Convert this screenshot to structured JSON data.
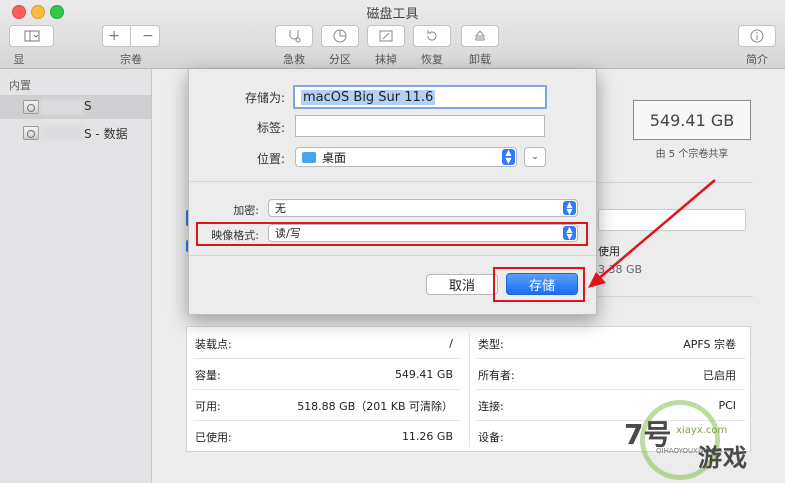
{
  "window": {
    "title": "磁盘工具"
  },
  "toolbar": {
    "display_label": "显示",
    "volume_label": "宗卷",
    "add_symbol": "+",
    "remove_symbol": "−",
    "firstaid_label": "急救",
    "partition_label": "分区",
    "erase_label": "抹掉",
    "restore_label": "恢复",
    "unmount_label": "卸载",
    "info_label": "简介",
    "icons": [
      "sidebar-icon",
      "stethoscope-icon",
      "pie-icon",
      "erase-icon",
      "restore-icon",
      "eject-icon",
      "info-icon"
    ]
  },
  "sidebar": {
    "header": "内置",
    "items": [
      {
        "label": "S",
        "selected": true
      },
      {
        "label": "S - 数据",
        "selected": false
      }
    ]
  },
  "main": {
    "capacity": "549.41 GB",
    "capacity_sub": "由 5 个宗卷共享",
    "used_text": "使用",
    "used_value": "3.38 GB"
  },
  "info": {
    "left": [
      {
        "key": "装载点:",
        "value": "/"
      },
      {
        "key": "容量:",
        "value": "549.41 GB"
      },
      {
        "key": "可用:",
        "value": "518.88 GB（201 KB 可清除）"
      },
      {
        "key": "已使用:",
        "value": "11.26 GB"
      }
    ],
    "right": [
      {
        "key": "类型:",
        "value": "APFS 宗卷"
      },
      {
        "key": "所有者:",
        "value": "已启用"
      },
      {
        "key": "连接:",
        "value": "PCI"
      },
      {
        "key": "设备:",
        "value": ""
      }
    ]
  },
  "sheet": {
    "save_as_label": "存储为:",
    "save_as_value": "macOS Big Sur 11.6",
    "tags_label": "标签:",
    "tags_value": "",
    "location_label": "位置:",
    "location_value": "桌面",
    "encryption_label": "加密:",
    "encryption_value": "无",
    "format_label": "映像格式:",
    "format_value": "读/写",
    "cancel_label": "取消",
    "save_label": "存储"
  },
  "watermark": {
    "number": "7号",
    "name": "游戏",
    "url": "xiayx.com",
    "pinyin": "QIHAOYOUXIWANG"
  },
  "colors": {
    "accent": "#1a6ff0",
    "highlight_box": "#e0151b"
  }
}
